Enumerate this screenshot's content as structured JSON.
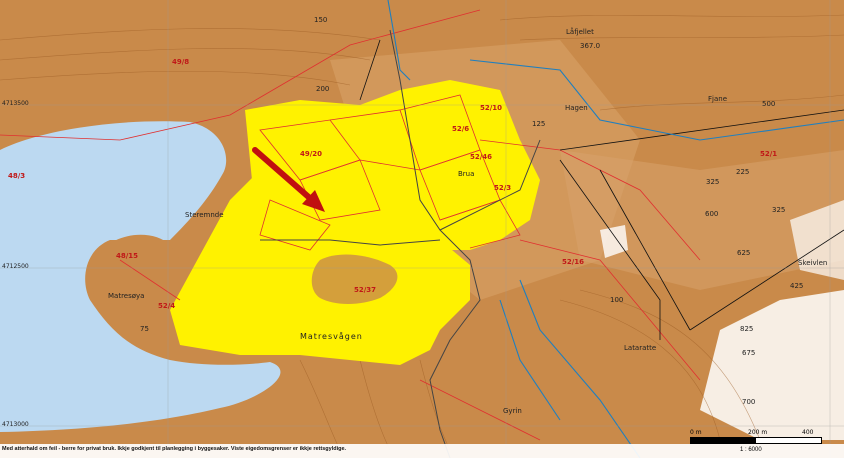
{
  "places": {
    "mathresvagen": "Matresvågen",
    "stereminde": "Steremnde",
    "matresoya": "Matresøya",
    "hagen": "Hagen",
    "skeivlen": "Skeivlen",
    "lataratte": "Lataratte",
    "gyrin": "Gyrin",
    "lofjellet": "Låfjellet",
    "fajane": "Fjane",
    "brua": "Brua"
  },
  "red_labels": [
    "48/15",
    "52/4",
    "52/46",
    "52/16",
    "52/1",
    "52/37",
    "49/20",
    "52/10",
    "52/6",
    "52/3",
    "48/3",
    "49/8"
  ],
  "elevations": [
    "150",
    "367.0",
    "500",
    "625",
    "825",
    "600",
    "675",
    "700",
    "225",
    "325",
    "200",
    "125",
    "100",
    "75",
    "325",
    "425"
  ],
  "coords": {
    "n1": "4713500",
    "n2": "4712500",
    "n3": "4713000"
  },
  "footer": {
    "disclaimer": "Med atterhald om feil - berre for privat bruk. Ikkje godkjent til planlegging i byggesaker. Viste eigedomsgrenser er ikkje rettsgyldige.",
    "scale_0": "0 m",
    "scale_mid": "200 m",
    "scale_end": "400 m",
    "ratio": "1 : 6000"
  },
  "colors": {
    "sea": "#bcd9f1",
    "terrain": "#c98a4a",
    "highlight": "#fff200",
    "parcel": "#e03030",
    "arrow": "#c01010"
  }
}
